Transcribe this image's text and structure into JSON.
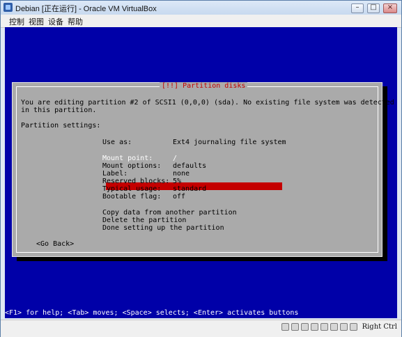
{
  "window": {
    "title": "Debian [正在运行] - Oracle VM VirtualBox",
    "controls": {
      "minimize": "–",
      "maximize": "□",
      "close": "×"
    }
  },
  "menubar": {
    "items": [
      "控制",
      "视图",
      "设备",
      "帮助"
    ]
  },
  "installer": {
    "dialog_title": "[!!] Partition disks",
    "description_line_1": "You are editing partition #2 of SCSI1 (0,0,0) (sda). No existing file system was detected",
    "description_line_2": "in this partition.",
    "section_label": "Partition settings:",
    "use_as_label": "Use as:",
    "use_as_value": "Ext4 journaling file system",
    "settings": [
      {
        "label": "Mount point:",
        "value": "/"
      },
      {
        "label": "Mount options:",
        "value": "defaults"
      },
      {
        "label": "Label:",
        "value": "none"
      },
      {
        "label": "Reserved blocks:",
        "value": "5%"
      },
      {
        "label": "Typical usage:",
        "value": "standard"
      },
      {
        "label": "Bootable flag:",
        "value": "off"
      }
    ],
    "actions": [
      "Copy data from another partition",
      "Delete the partition",
      "Done setting up the partition"
    ],
    "go_back": "<Go Back>",
    "help_line": "<F1> for help; <Tab> moves; <Space> selects; <Enter> activates buttons",
    "colors": {
      "screen_blue": "#0000a8",
      "dialog_gray": "#aaaaaa",
      "accent_red": "#c40000"
    }
  },
  "statusbar": {
    "right_ctrl_label": "Right Ctrl",
    "icons": [
      "hdd-icon",
      "cd-icon",
      "usb-icon",
      "network-icon",
      "shared-folder-icon",
      "display-icon",
      "video-capture-icon",
      "mouse-integration-icon"
    ]
  }
}
